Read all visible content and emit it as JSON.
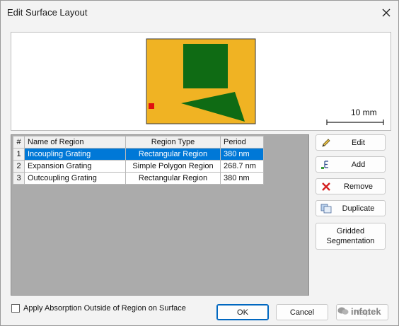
{
  "window": {
    "title": "Edit Surface Layout"
  },
  "preview": {
    "scale_label": "10 mm",
    "colors": {
      "substrate": "#f0b323",
      "region": "#0f6b14",
      "marker": "#e01010"
    }
  },
  "table": {
    "columns": [
      "#",
      "Name of Region",
      "Region Type",
      "Period"
    ],
    "rows": [
      {
        "num": "1",
        "name": "Incoupling Grating",
        "type": "Rectangular Region",
        "period": "380 nm",
        "selected": true
      },
      {
        "num": "2",
        "name": "Expansion Grating",
        "type": "Simple Polygon Region",
        "period": "268.7 nm",
        "selected": false
      },
      {
        "num": "3",
        "name": "Outcoupling Grating",
        "type": "Rectangular Region",
        "period": "380 nm",
        "selected": false
      }
    ]
  },
  "actions": {
    "edit": {
      "label": "Edit",
      "icon": "pencil-icon"
    },
    "add": {
      "label": "Add",
      "icon": "add-icon"
    },
    "remove": {
      "label": "Remove",
      "icon": "red-x-icon"
    },
    "duplicate": {
      "label": "Duplicate",
      "icon": "duplicate-icon"
    },
    "gridded_line1": "Gridded",
    "gridded_line2": "Segmentation"
  },
  "footer": {
    "absorption_label": "Apply Absorption Outside of Region on Surface",
    "absorption_checked": false,
    "ok_label": "OK",
    "cancel_label": "Cancel",
    "help_label": "Help",
    "watermark": "infotek"
  },
  "theme": {
    "selection": "#0078d7",
    "background": "#f3f3f3"
  }
}
